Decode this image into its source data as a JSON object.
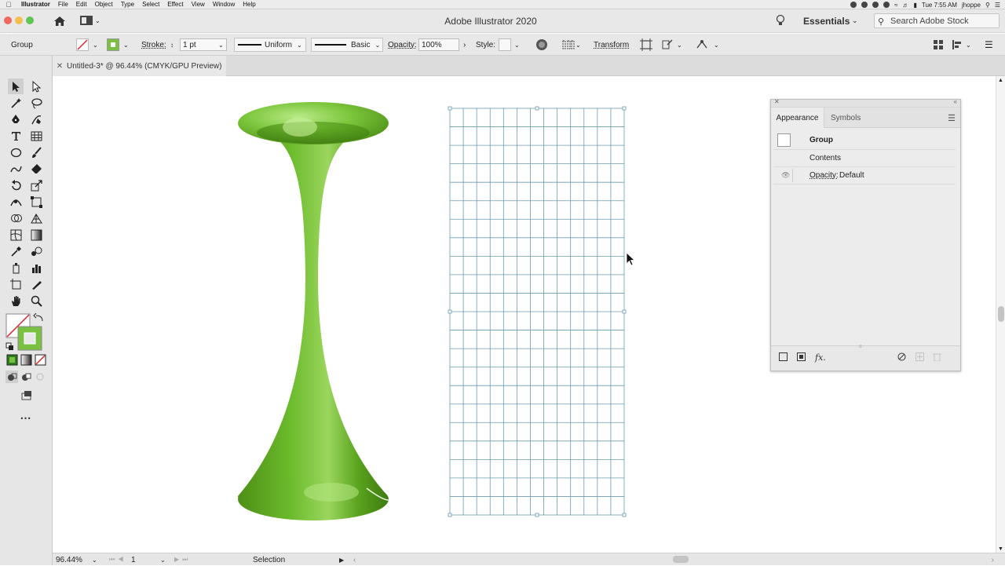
{
  "menubar": {
    "apple": "",
    "items": [
      "Illustrator",
      "File",
      "Edit",
      "Object",
      "Type",
      "Select",
      "Effect",
      "View",
      "Window",
      "Help"
    ],
    "clock": "Tue 7:55 AM",
    "user": "jhoppe"
  },
  "titlebar": {
    "title": "Adobe Illustrator 2020",
    "workspace": "Essentials",
    "search_placeholder": "Search Adobe Stock"
  },
  "controlbar": {
    "selection_label": "Group",
    "stroke_label": "Stroke:",
    "stroke_value": "1 pt",
    "profile_label": "Uniform",
    "brush_label": "Basic",
    "opacity_label": "Opacity:",
    "opacity_value": "100%",
    "style_label": "Style:",
    "transform_label": "Transform",
    "fill_color": "#7ac143",
    "stroke_color": "none"
  },
  "document": {
    "tab_title": "Untitled-3* @ 96.44% (CMYK/GPU Preview)"
  },
  "appearance_panel": {
    "tabs": [
      "Appearance",
      "Symbols"
    ],
    "object_type": "Group",
    "contents_label": "Contents",
    "opacity_label": "Opacity:",
    "opacity_value": "Default"
  },
  "statusbar": {
    "zoom": "96.44%",
    "artboard": "1",
    "tool": "Selection"
  },
  "artwork": {
    "vase_color": "#6ab82e",
    "grid_color": "#6a9bb0",
    "grid_columns": 13,
    "grid_rows": 22
  }
}
